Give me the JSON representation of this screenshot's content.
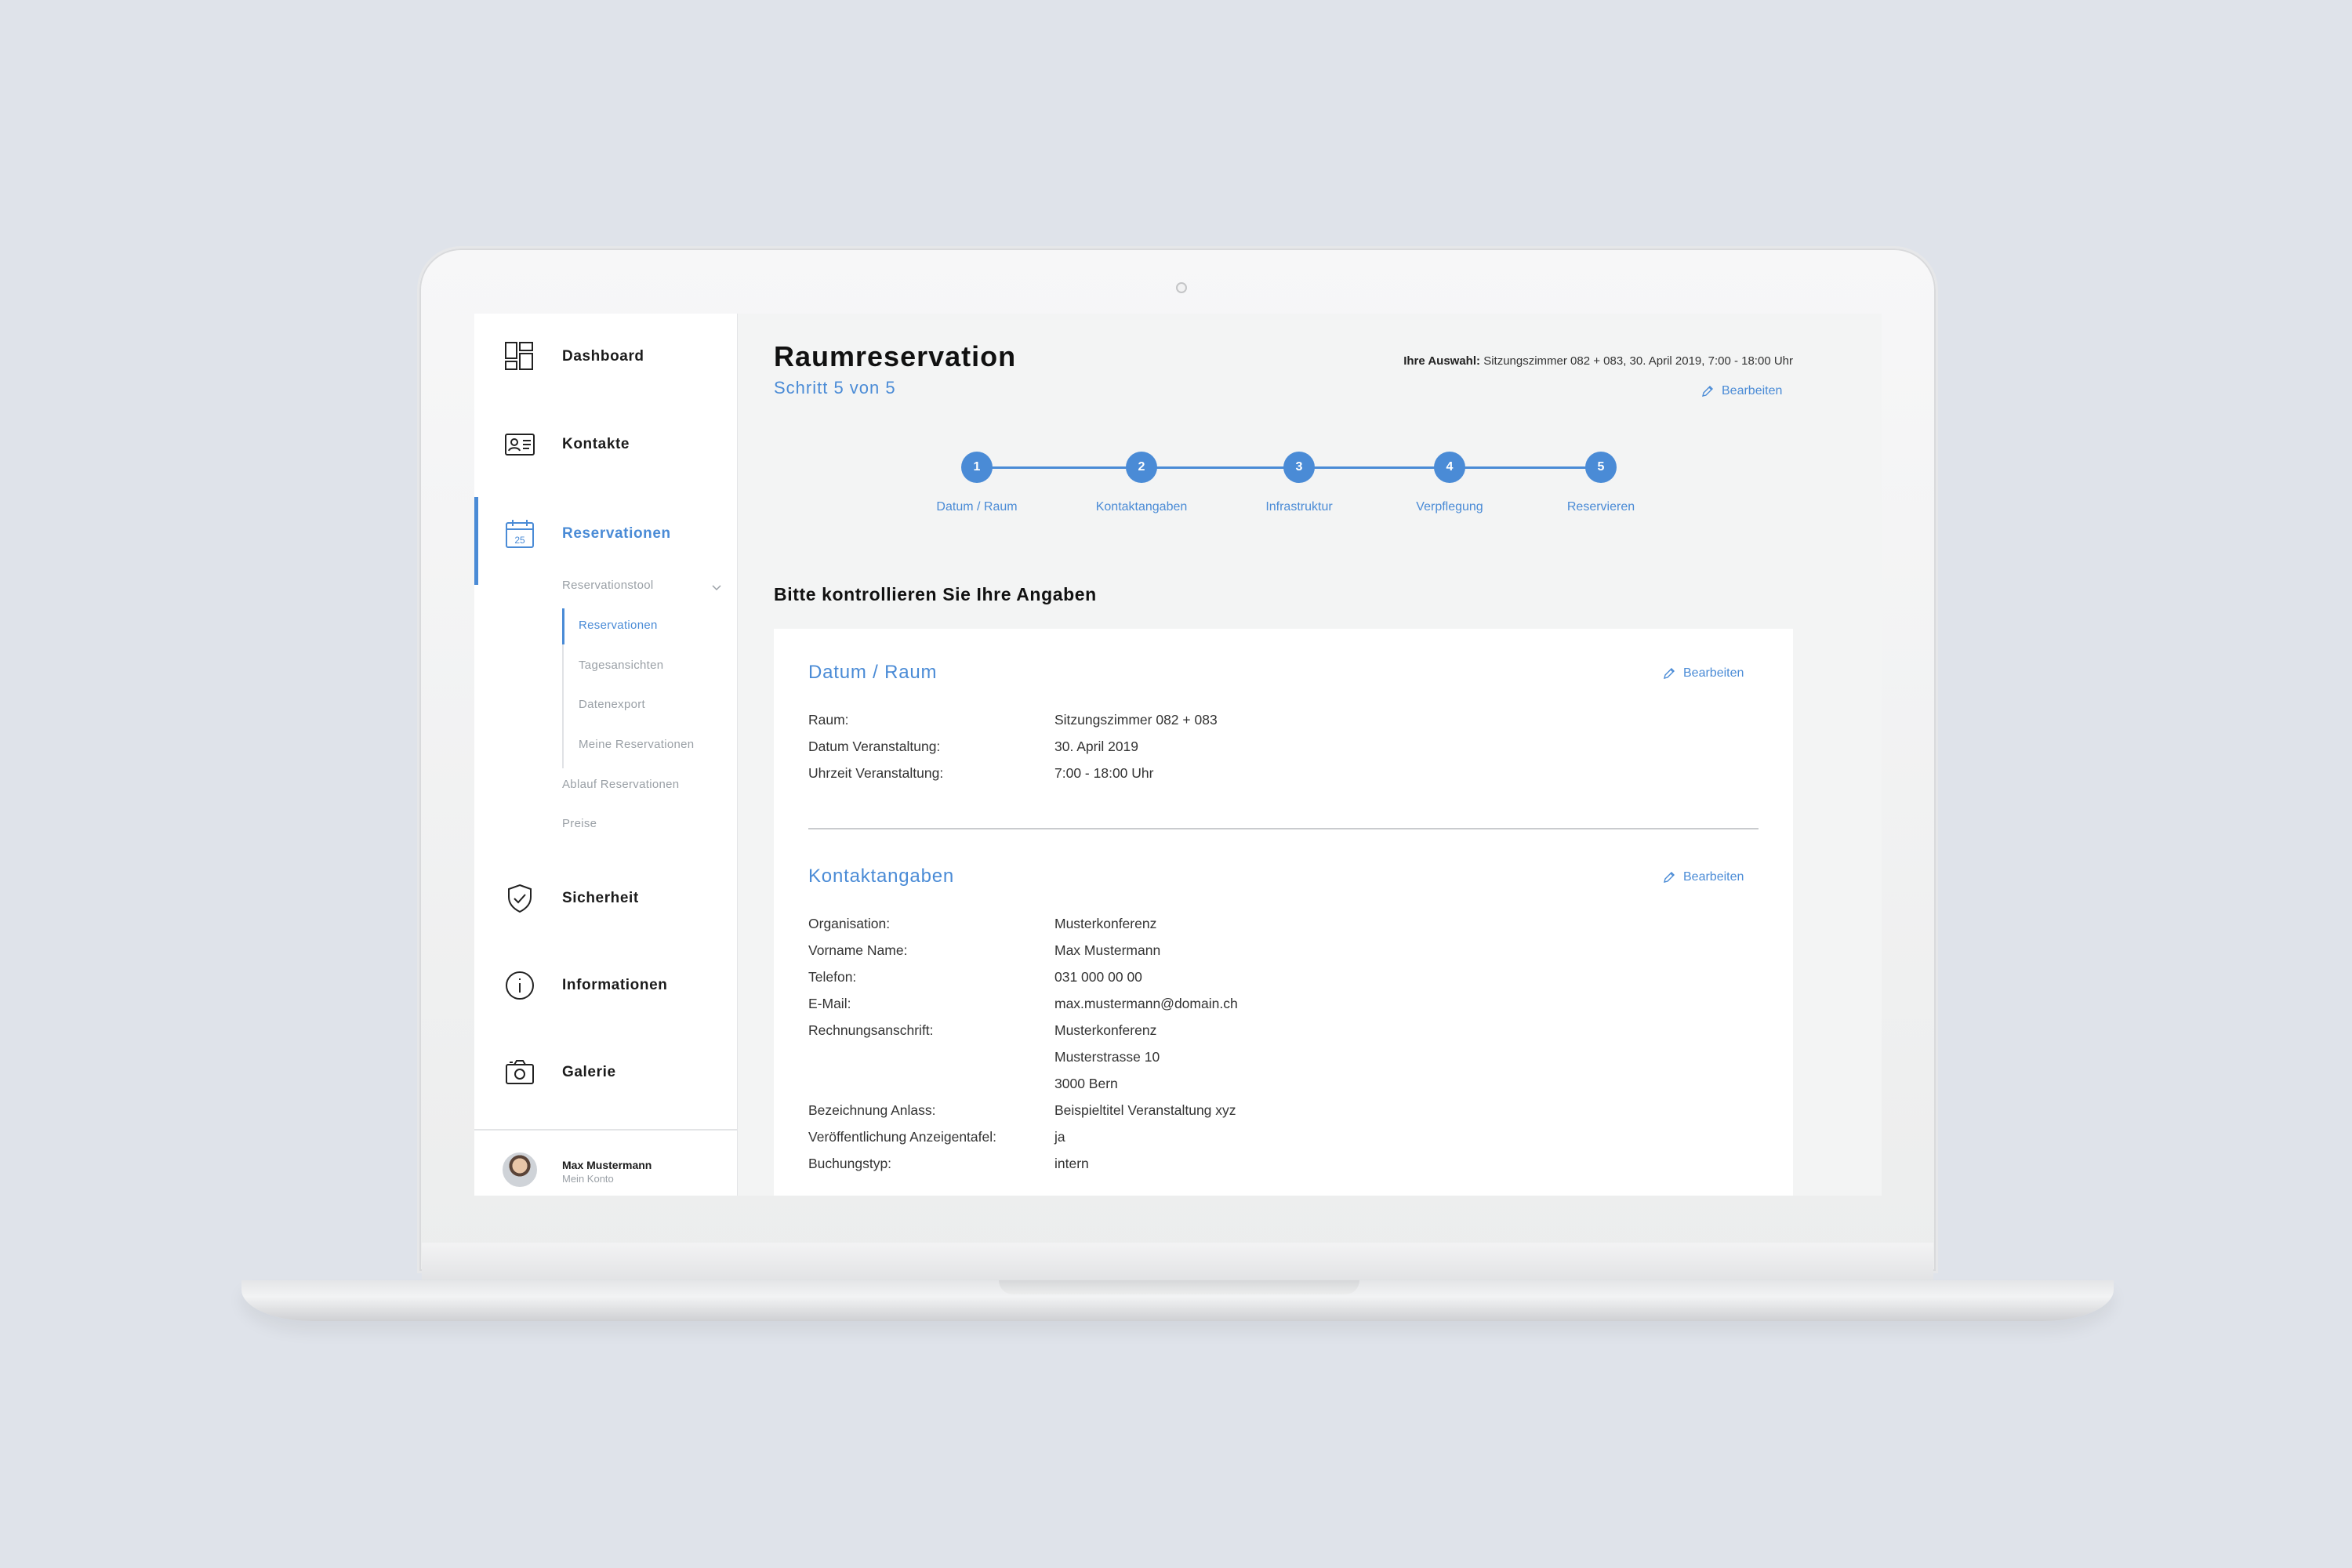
{
  "sidebar": {
    "nav": [
      {
        "label": "Dashboard",
        "icon": "dashboard-icon"
      },
      {
        "label": "Kontakte",
        "icon": "contact-card-icon"
      },
      {
        "label": "Reservationen",
        "icon": "calendar-icon",
        "icon_text": "25"
      },
      {
        "label": "Sicherheit",
        "icon": "shield-icon"
      },
      {
        "label": "Informationen",
        "icon": "info-icon"
      },
      {
        "label": "Galerie",
        "icon": "camera-icon"
      }
    ],
    "submenu": {
      "group_label": "Reservationstool",
      "items": [
        "Reservationen",
        "Tagesansichten",
        "Datenexport",
        "Meine Reservationen"
      ],
      "extra": [
        "Ablauf Reservationen",
        "Preise"
      ]
    },
    "user": {
      "name": "Max Mustermann",
      "sub": "Mein Konto"
    }
  },
  "header": {
    "title": "Raumreservation",
    "step": "Schritt 5 von 5",
    "selection_label": "Ihre Auswahl:",
    "selection_value": "Sitzungszimmer 082 + 083, 30. April 2019, 7:00 - 18:00 Uhr",
    "edit_label": "Bearbeiten"
  },
  "stepper": {
    "steps": [
      {
        "num": "1",
        "label": "Datum / Raum"
      },
      {
        "num": "2",
        "label": "Kontaktangaben"
      },
      {
        "num": "3",
        "label": "Infrastruktur"
      },
      {
        "num": "4",
        "label": "Verpflegung"
      },
      {
        "num": "5",
        "label": "Reservieren"
      }
    ]
  },
  "main": {
    "heading": "Bitte kontrollieren Sie Ihre Angaben",
    "sections": [
      {
        "title": "Datum / Raum",
        "edit_label": "Bearbeiten",
        "rows": [
          {
            "key": "Raum:",
            "value": "Sitzungszimmer 082 + 083"
          },
          {
            "key": "Datum Veranstaltung:",
            "value": "30. April 2019"
          },
          {
            "key": "Uhrzeit Veranstaltung:",
            "value": "7:00 - 18:00 Uhr"
          }
        ]
      },
      {
        "title": "Kontaktangaben",
        "edit_label": "Bearbeiten",
        "rows": [
          {
            "key": "Organisation:",
            "value": "Musterkonferenz"
          },
          {
            "key": "Vorname Name:",
            "value": "Max Mustermann"
          },
          {
            "key": "Telefon:",
            "value": "031 000 00 00"
          },
          {
            "key": "E-Mail:",
            "value": "max.mustermann@domain.ch"
          },
          {
            "key": "Rechnungsanschrift:",
            "value": "Musterkonferenz"
          },
          {
            "key": "",
            "value": "Musterstrasse 10"
          },
          {
            "key": "",
            "value": "3000 Bern"
          },
          {
            "key": "Bezeichnung Anlass:",
            "value": "Beispieltitel Veranstaltung xyz"
          },
          {
            "key": "Veröffentlichung Anzeigentafel:",
            "value": "ja"
          },
          {
            "key": "Buchungstyp:",
            "value": "intern"
          }
        ]
      }
    ]
  },
  "colors": {
    "accent": "#4a8bd6",
    "background": "#dfe3ea",
    "screen": "#f3f4f4"
  }
}
